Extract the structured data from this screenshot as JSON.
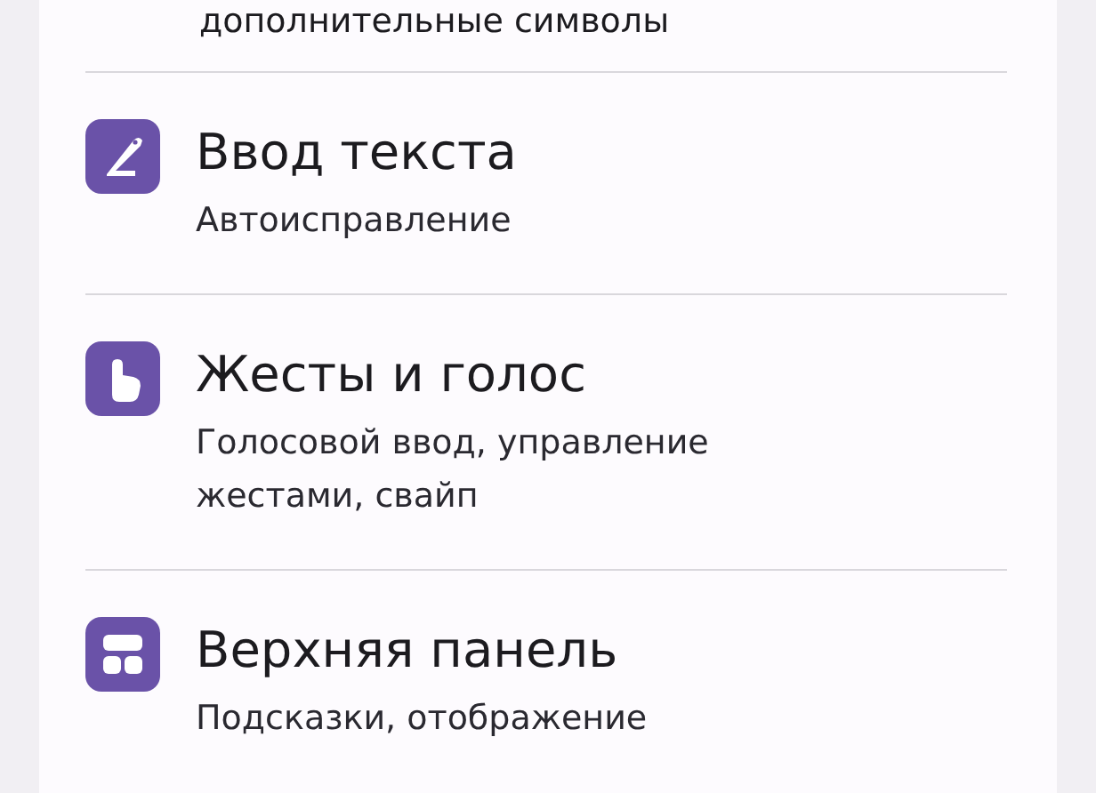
{
  "top_subtitle": "дополнительные символы",
  "items": [
    {
      "kind": "pen",
      "title": "Ввод текста",
      "subtitle": "Автоисправление"
    },
    {
      "kind": "hand",
      "title": "Жесты и голос",
      "subtitle": "Голосовой ввод, управление жестами, свайп"
    },
    {
      "kind": "panel",
      "title": "Верхняя панель",
      "subtitle": "Подсказки, отображение"
    }
  ]
}
